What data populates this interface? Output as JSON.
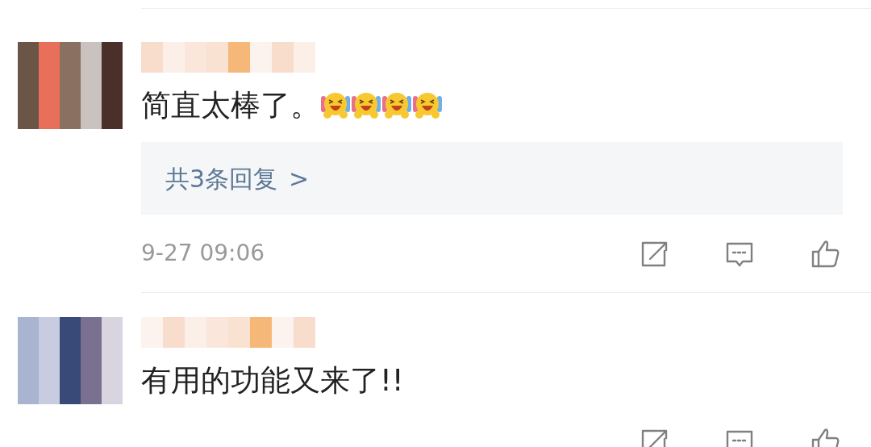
{
  "comments": [
    {
      "text": "简直太棒了。",
      "emojis": [
        {
          "kind": "laughing"
        },
        {
          "kind": "laughing"
        },
        {
          "kind": "laughing"
        },
        {
          "kind": "laughing"
        }
      ],
      "replies": "共3条回复",
      "replies_arrow": ">",
      "time": "9-27 09:06",
      "actions": true
    },
    {
      "text": "有用的功能又来了!!",
      "actions": true
    }
  ]
}
